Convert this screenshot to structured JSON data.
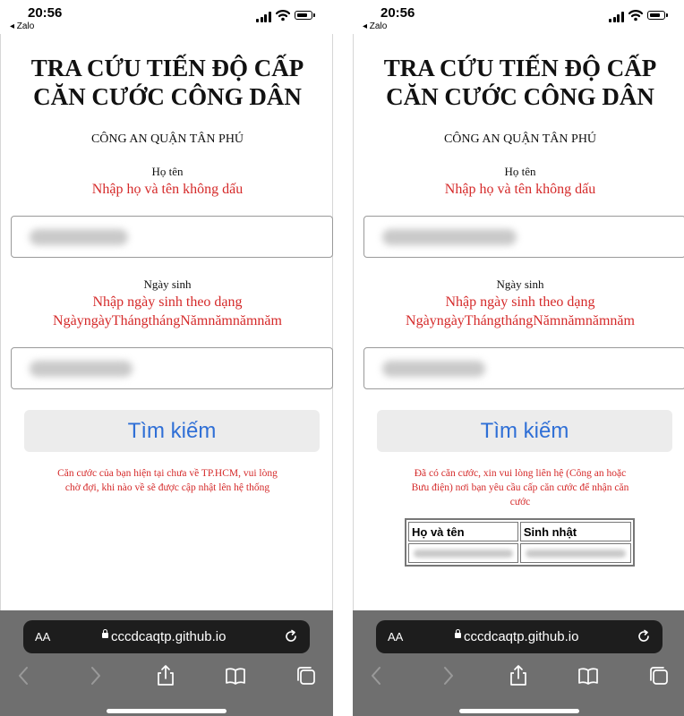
{
  "phones": [
    {
      "status": {
        "time": "20:56",
        "back_app": "◂ Zalo"
      },
      "page": {
        "title_line1": "TRA CỨU TIẾN ĐỘ CẤP",
        "title_line2": "CĂN CƯỚC CÔNG DÂN",
        "org": "CÔNG AN QUẬN TÂN PHÚ",
        "name_label": "Họ tên",
        "name_hint": "Nhập họ và tên không dấu",
        "dob_label": "Ngày sinh",
        "dob_hint_line1": "Nhập ngày sinh theo dạng",
        "dob_hint_line2": "NgàyngàyThángthángNămnămnămnăm",
        "search_button": "Tìm kiếm",
        "message_line1": "Căn cước của bạn hiện tại chưa về TP.HCM, vui lòng",
        "message_line2": "chờ đợi, khi nào về sẽ được cập nhật lên hệ thống"
      },
      "browser": {
        "aa_label": "AA",
        "url": "cccdcaqtp.github.io"
      }
    },
    {
      "status": {
        "time": "20:56",
        "back_app": "◂ Zalo"
      },
      "page": {
        "title_line1": "TRA CỨU TIẾN ĐỘ CẤP",
        "title_line2": "CĂN CƯỚC CÔNG DÂN",
        "org": "CÔNG AN QUẬN TÂN PHÚ",
        "name_label": "Họ tên",
        "name_hint": "Nhập họ và tên không dấu",
        "dob_label": "Ngày sinh",
        "dob_hint_line1": "Nhập ngày sinh theo dạng",
        "dob_hint_line2": "NgàyngàyThángthángNămnămnămnăm",
        "search_button": "Tìm kiếm",
        "message_line1": "Đã có căn cước, xin vui lòng liên hệ (Công an hoặc",
        "message_line2": "Bưu điện) nơi bạn yêu cầu cấp căn cước để nhận căn",
        "message_line3": "cước",
        "table_headers": [
          "Họ và tên",
          "Sinh nhật"
        ]
      },
      "browser": {
        "aa_label": "AA",
        "url": "cccdcaqtp.github.io"
      }
    }
  ],
  "colors": {
    "hint_red": "#d52a2a",
    "link_blue": "#2f6fd6",
    "button_bg": "#ececec",
    "toolbar_bg": "#6f6f6f",
    "urlbar_bg": "#1d1d1d"
  },
  "icons": [
    "signal-icon",
    "wifi-icon",
    "battery-icon",
    "lock-icon",
    "reload-icon",
    "back-arrow-icon",
    "forward-arrow-icon",
    "share-icon",
    "bookmarks-icon",
    "tabs-icon"
  ]
}
